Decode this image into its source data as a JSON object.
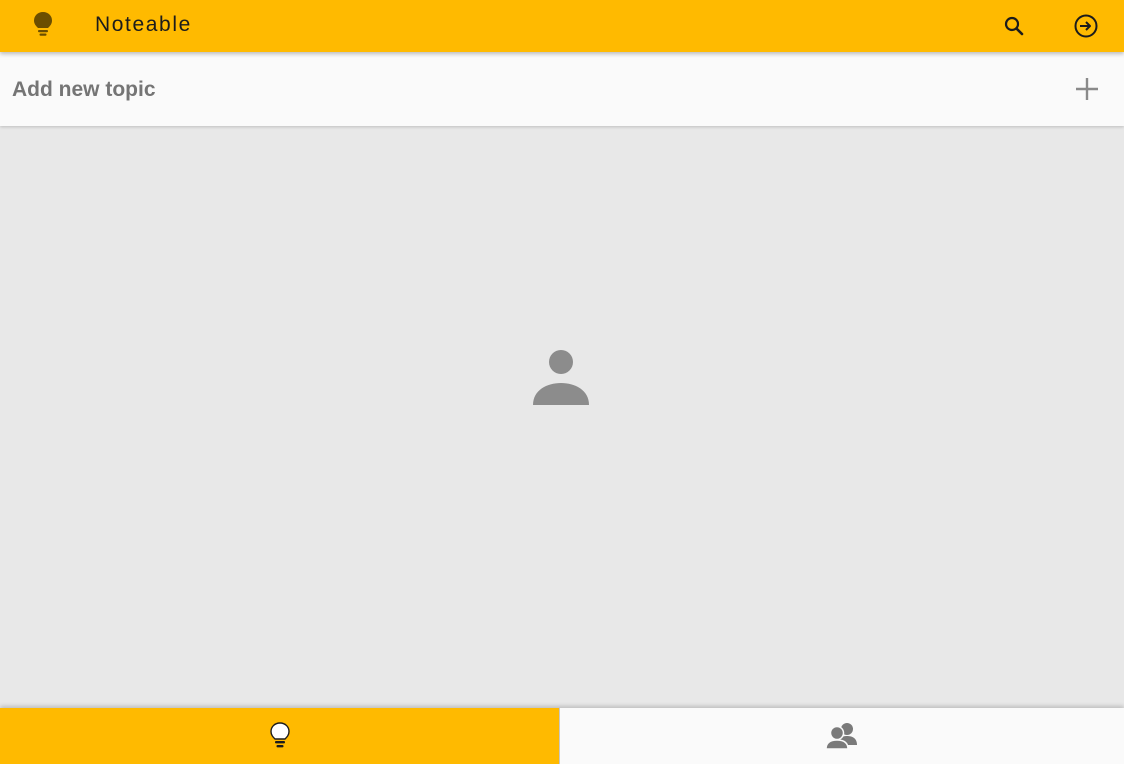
{
  "header": {
    "title": "Noteable",
    "logo_icon": "lightbulb-icon",
    "search_icon": "search-icon",
    "logout_icon": "logout-icon"
  },
  "add_topic": {
    "label": "Add new topic",
    "add_icon": "plus-icon"
  },
  "main": {
    "placeholder_icon": "person-icon"
  },
  "bottom_nav": {
    "tabs": [
      {
        "icon": "lightbulb-icon",
        "active": true
      },
      {
        "icon": "people-icon",
        "active": false
      }
    ]
  },
  "colors": {
    "accent": "#ffba00",
    "background": "#e8e8e8",
    "surface": "#fafafa",
    "muted_text": "#757575"
  }
}
